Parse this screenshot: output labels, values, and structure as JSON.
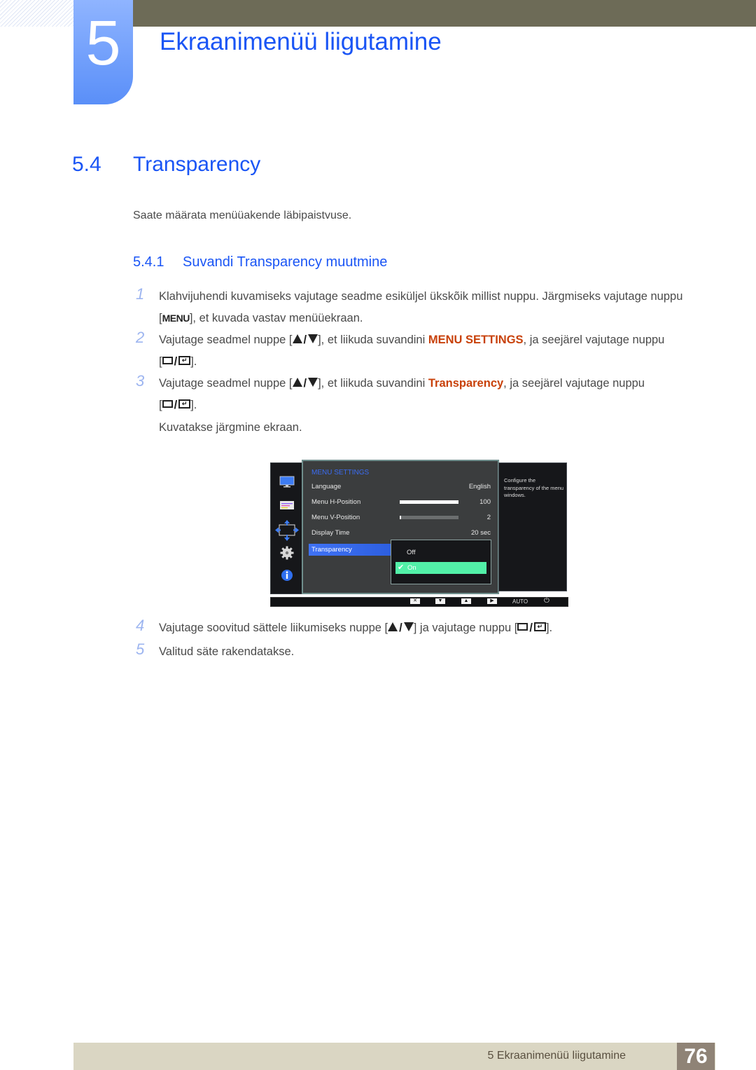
{
  "chapter": {
    "number": "5",
    "title": "Ekraanimenüü liigutamine"
  },
  "section": {
    "number": "5.4",
    "title": "Transparency",
    "intro": "Saate määrata menüüakende läbipaistvuse."
  },
  "subsection": {
    "number": "5.4.1",
    "title": "Suvandi Transparency muutmine"
  },
  "steps": [
    {
      "num": "1",
      "text_a": "Klahvijuhendi kuvamiseks vajutage seadme esiküljel ükskõik millist nuppu. Järgmiseks vajutage nuppu [",
      "key": "MENU",
      "text_b": "], et kuvada vastav menüüekraan."
    },
    {
      "num": "2",
      "text_a": "Vajutage seadmel nuppe [",
      "text_b": "], et liikuda suvandini ",
      "highlight": "MENU SETTINGS",
      "text_c": ", ja seejärel vajutage nuppu",
      "text_d": "[",
      "text_e": "]."
    },
    {
      "num": "3",
      "text_a": "Vajutage seadmel nuppe [",
      "text_b": "], et liikuda suvandini ",
      "highlight": "Transparency",
      "text_c": ", ja seejärel vajutage nuppu",
      "text_d": "[",
      "text_e": "].",
      "note": "Kuvatakse järgmine ekraan."
    },
    {
      "num": "4",
      "text_a": "Vajutage soovitud sättele liikumiseks nuppe [",
      "text_b": "] ja vajutage nuppu [",
      "text_c": "]."
    },
    {
      "num": "5",
      "text_a": "Valitud säte rakendatakse."
    }
  ],
  "osd": {
    "side_icons": [
      "monitor-icon",
      "picture-settings-icon",
      "position-arrows-icon",
      "gear-icon",
      "info-icon"
    ],
    "heading": "MENU SETTINGS",
    "rows": [
      {
        "label": "Language",
        "value": "English"
      },
      {
        "label": "Menu H-Position",
        "value": "100",
        "level": 1.0
      },
      {
        "label": "Menu V-Position",
        "value": "2",
        "level": 0.02
      },
      {
        "label": "Display Time",
        "value": "20 sec"
      }
    ],
    "selected": "Transparency",
    "options": [
      {
        "label": "Off",
        "selected": false
      },
      {
        "label": "On",
        "selected": true
      }
    ],
    "help": "Configure the transparency of the menu windows.",
    "bottom_buttons": [
      "close",
      "down",
      "up",
      "enter",
      "AUTO",
      "power"
    ],
    "auto_label": "AUTO",
    "colors": {
      "heading": "#3b6cf2",
      "selected_row": "#3f72f5",
      "selected_option": "#52f0a8"
    }
  },
  "footer": {
    "chapter_label": "5 Ekraanimenüü liigutamine",
    "page": "76"
  },
  "colors": {
    "heading_blue": "#1a55f5",
    "highlight_orange": "#c8410a",
    "topbar": "#6d6b57",
    "footer_band": "#dad6c3",
    "page_box": "#8f8376"
  }
}
